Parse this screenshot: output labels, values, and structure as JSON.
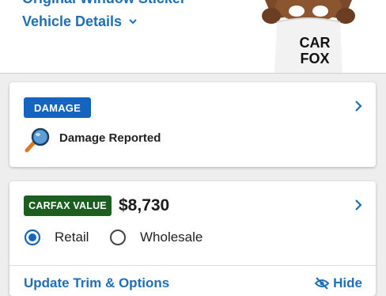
{
  "header": {
    "window_sticker_link": "Original Window Sticker",
    "vehicle_details_label": "Vehicle Details",
    "mascot_text_line1": "CAR",
    "mascot_text_line2": "FOX"
  },
  "damage_card": {
    "badge": "DAMAGE",
    "status_text": "Damage Reported"
  },
  "value_card": {
    "badge": "CARFAX VALUE",
    "price": "$8,730",
    "options": [
      {
        "label": "Retail",
        "selected": true
      },
      {
        "label": "Wholesale",
        "selected": false
      }
    ],
    "update_link": "Update Trim & Options",
    "hide_label": "Hide"
  },
  "colors": {
    "link_blue": "#1f6fb6",
    "damage_badge": "#1565c0",
    "value_badge": "#1b5e20"
  }
}
